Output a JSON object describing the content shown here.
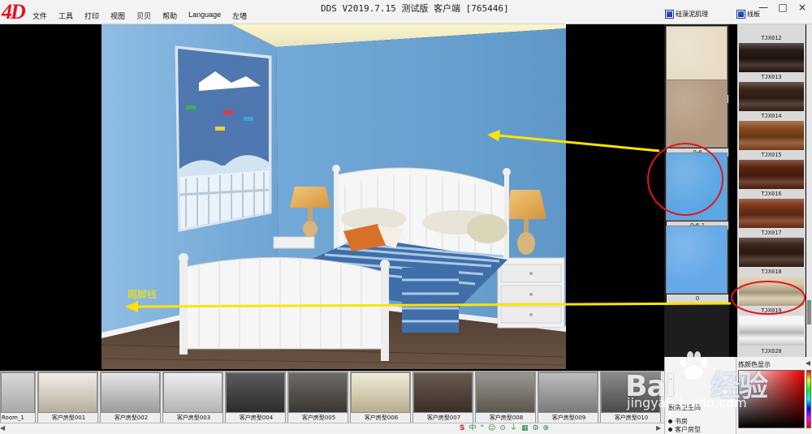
{
  "app": {
    "logo": "4D",
    "title": "DDS  V2019.7.15 测试版 客户端 [765446]",
    "menu": [
      "文件",
      "工具",
      "打印",
      "视图",
      "贝贝",
      "帮助",
      "Language",
      "左墙"
    ],
    "window_controls": [
      "—",
      "□",
      "×"
    ]
  },
  "panels": {
    "wallpaper_header": "硅藻泥肌理",
    "trim_header": "线板"
  },
  "wallpapers": [
    {
      "label": "0-5",
      "color": "#e8dcc6"
    },
    {
      "label": "0-6",
      "color": "#b29a80"
    },
    {
      "label": "0-6.1",
      "color": "#5ba6e3"
    },
    {
      "label": "0",
      "color": "#65a9e8"
    }
  ],
  "trims": [
    {
      "label": "TJX012",
      "color": "#2a1a14"
    },
    {
      "label": "TJX013",
      "color": "#3b2418"
    },
    {
      "label": "TJX014",
      "color": "#8a4b1e"
    },
    {
      "label": "TJX015",
      "color": "#5a2410"
    },
    {
      "label": "TJX016",
      "color": "#7a3418"
    },
    {
      "label": "TJX017",
      "color": "#3a2216"
    },
    {
      "label": "TJX018",
      "color": "#d8c8a8"
    },
    {
      "label": "TJX019",
      "color": "#e8e8e4"
    },
    {
      "label": "TJX020",
      "color": "#f4f4f4"
    }
  ],
  "rooms": [
    {
      "label": "Room_1"
    },
    {
      "label": "客户房型001"
    },
    {
      "label": "客户房型002"
    },
    {
      "label": "客户房型003"
    },
    {
      "label": "客户房型004"
    },
    {
      "label": "客户房型005"
    },
    {
      "label": "客户房型006"
    },
    {
      "label": "客户房型007"
    },
    {
      "label": "客户房型008"
    },
    {
      "label": "客户房型009"
    },
    {
      "label": "客户房型010"
    }
  ],
  "room_tree": [
    "厨房卫生间",
    "书房",
    "客户房型"
  ],
  "color_panel": {
    "title": "拣颜色显示"
  },
  "annotation": {
    "skirting": "踢脚线"
  },
  "statusbar": {
    "ime": [
      "中",
      "°",
      "☺",
      "⊙",
      "⏚",
      "▦",
      "⚙",
      "⊕"
    ]
  },
  "watermark": {
    "text_a": "Bai",
    "text_b": "经验",
    "url": "jingyan.baidu.com"
  },
  "colors": {
    "wall_blue": "#74aad6",
    "accent_yellow": "#ffe400",
    "highlight_red": "#e3141c"
  }
}
